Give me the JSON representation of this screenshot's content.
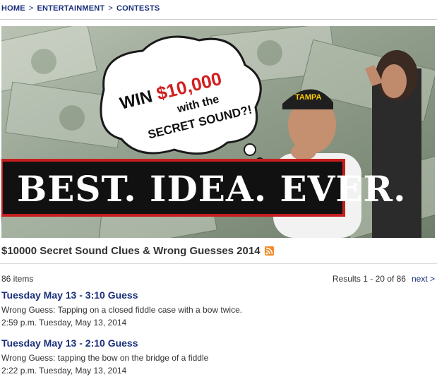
{
  "breadcrumb": {
    "items": [
      "HOME",
      "ENTERTAINMENT",
      "CONTESTS"
    ],
    "separator": ">"
  },
  "banner": {
    "bubble_win": "WIN",
    "bubble_amount": "$10,000",
    "bubble_with_the": "with the",
    "bubble_secret": "SECRET SOUND?!",
    "headline": "BEST. IDEA. EVER."
  },
  "page": {
    "title": "$10000 Secret Sound Clues & Wrong Guesses 2014"
  },
  "listing": {
    "count": "86 items",
    "results": "Results 1 - 20 of 86",
    "next": "next >"
  },
  "items": [
    {
      "title": "Tuesday May 13 - 3:10 Guess",
      "description": "Wrong Guess: Tapping on a closed fiddle case with a bow twice.",
      "date": "2:59 p.m. Tuesday, May 13, 2014"
    },
    {
      "title": "Tuesday May 13 - 2:10 Guess",
      "description": "Wrong Guess: tapping the bow on the bridge of a fiddle",
      "date": "2:22 p.m. Tuesday, May 13, 2014"
    }
  ],
  "colors": {
    "link": "#1a2f7a",
    "rss": "#f38a26",
    "win_red": "#d21f1f"
  }
}
